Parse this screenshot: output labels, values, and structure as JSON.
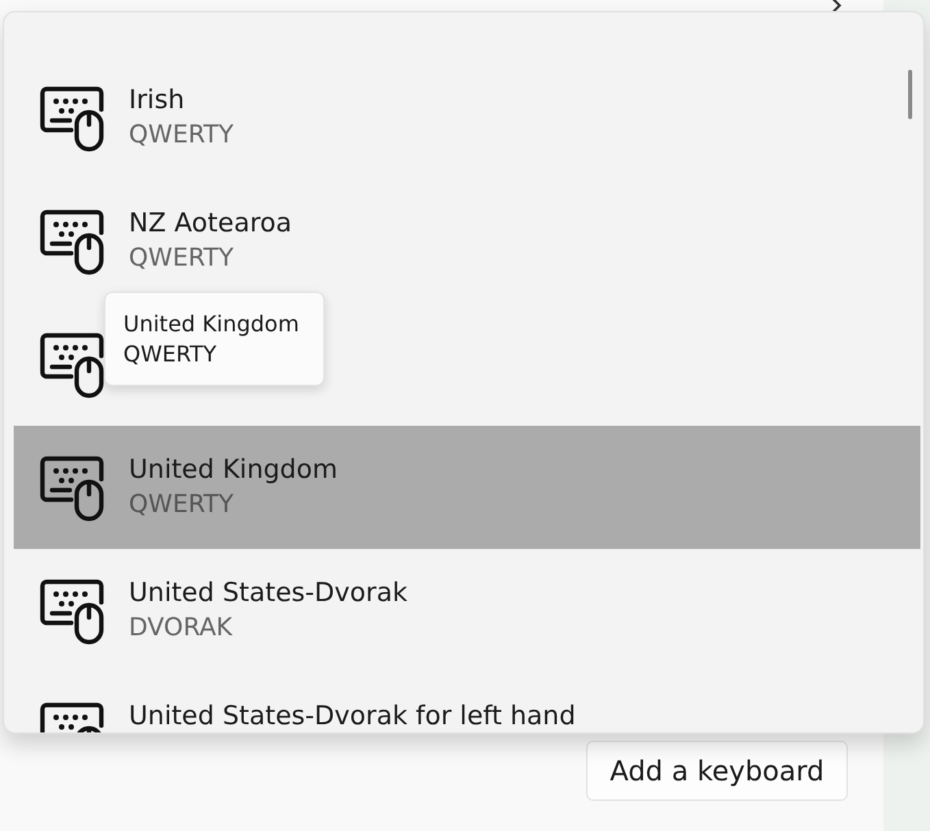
{
  "background": {
    "add_button": "Add a keyboard"
  },
  "keyboards": [
    {
      "title": "Irish",
      "subtitle": "QWERTY",
      "selected": false
    },
    {
      "title": "NZ Aotearoa",
      "subtitle": "QWERTY",
      "selected": false
    },
    {
      "selected": false,
      "tooltip": {
        "title": "United Kingdom",
        "subtitle": "QWERTY"
      }
    },
    {
      "title": "United Kingdom",
      "subtitle": "QWERTY",
      "selected": true
    },
    {
      "title": "United States-Dvorak",
      "subtitle": "DVORAK",
      "selected": false
    },
    {
      "title": "United States-Dvorak for left hand",
      "selected": false
    }
  ]
}
